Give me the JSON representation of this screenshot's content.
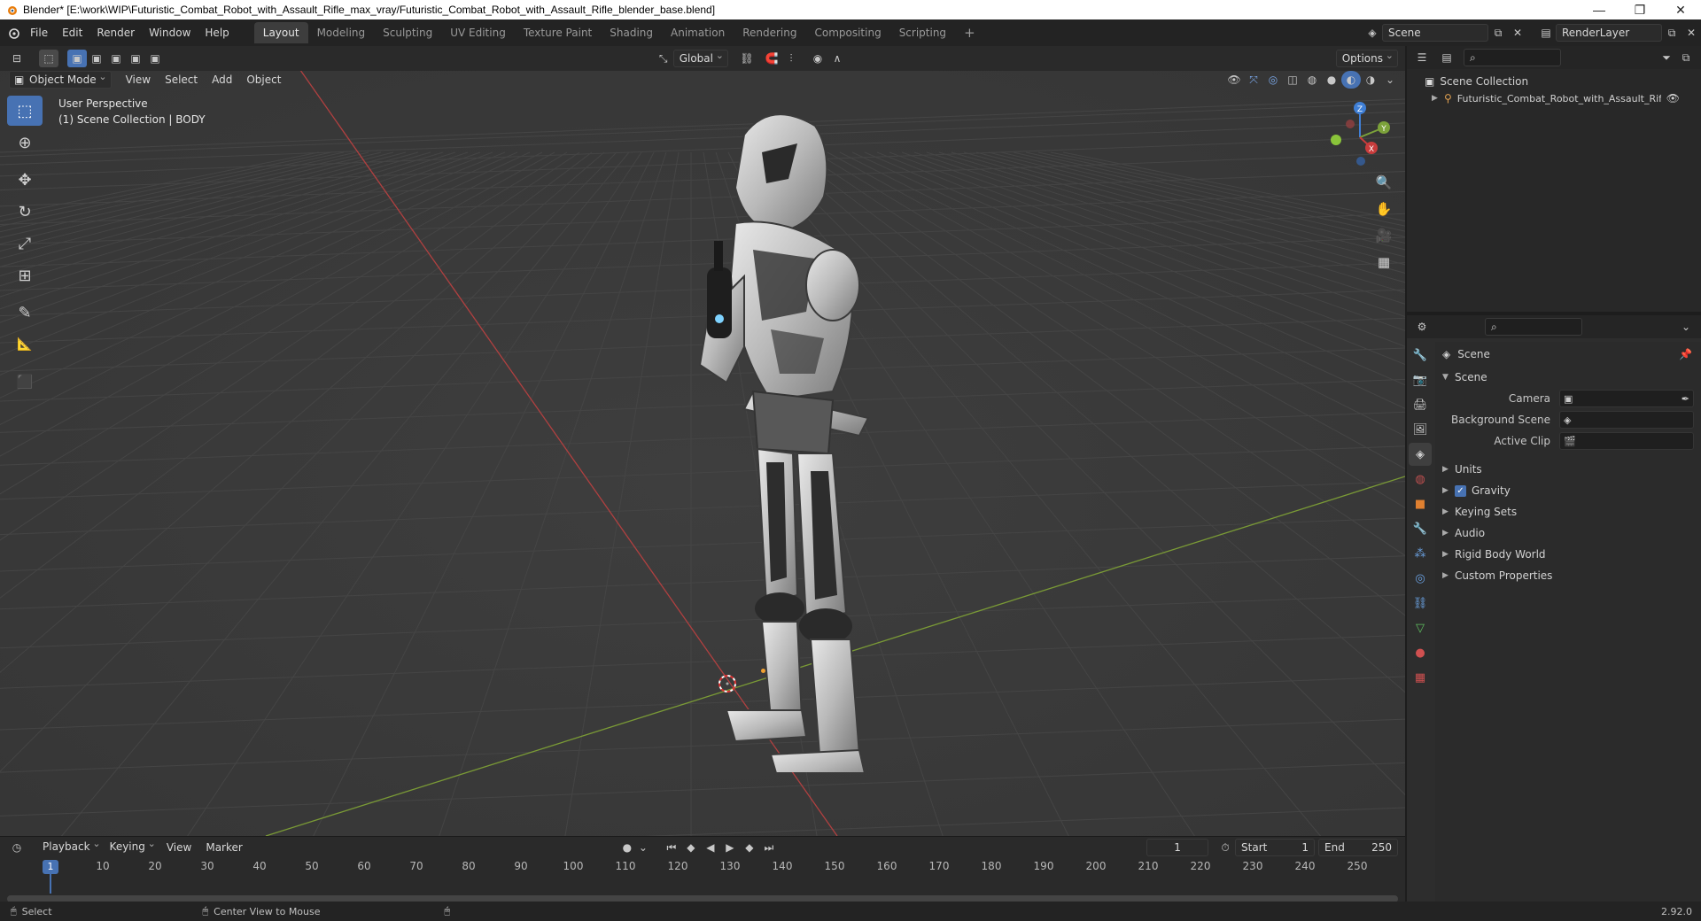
{
  "window": {
    "title": "Blender* [E:\\work\\WIP\\Futuristic_Combat_Robot_with_Assault_Rifle_max_vray/Futuristic_Combat_Robot_with_Assault_Rifle_blender_base.blend]",
    "minimize": "—",
    "maximize": "❐",
    "close": "✕"
  },
  "menubar": {
    "items": [
      "File",
      "Edit",
      "Render",
      "Window",
      "Help"
    ],
    "workspaces": [
      "Layout",
      "Modeling",
      "Sculpting",
      "UV Editing",
      "Texture Paint",
      "Shading",
      "Animation",
      "Rendering",
      "Compositing",
      "Scripting"
    ],
    "active_workspace": "Layout",
    "add_workspace": "+",
    "scene_name": "Scene",
    "render_layer": "RenderLayer"
  },
  "viewport_header": {
    "transform_orientation": "Global",
    "options_label": "Options",
    "mode": "Object Mode",
    "menus": [
      "View",
      "Select",
      "Add",
      "Object"
    ]
  },
  "viewport": {
    "perspective_label": "User Perspective",
    "collection_label": "(1) Scene Collection | BODY",
    "gizmo_axes": {
      "x": "X",
      "y": "Y",
      "z": "Z"
    },
    "tools": [
      {
        "name": "select-box-tool",
        "glyph": "⬚"
      },
      {
        "name": "cursor-tool",
        "glyph": "⊕"
      },
      {
        "name": "move-tool",
        "glyph": "✥"
      },
      {
        "name": "rotate-tool",
        "glyph": "↻"
      },
      {
        "name": "scale-tool",
        "glyph": "⤢"
      },
      {
        "name": "transform-tool",
        "glyph": "⊞"
      },
      {
        "name": "annotate-tool",
        "glyph": "✎"
      },
      {
        "name": "measure-tool",
        "glyph": "📐"
      },
      {
        "name": "add-cube-tool",
        "glyph": "⬛"
      }
    ]
  },
  "outliner": {
    "root": "Scene Collection",
    "items": [
      {
        "label": "Futuristic_Combat_Robot_with_Assault_Rifle"
      }
    ]
  },
  "properties": {
    "context_title": "Scene",
    "section_title": "Scene",
    "fields": [
      {
        "label": "Camera",
        "value": ""
      },
      {
        "label": "Background Scene",
        "value": ""
      },
      {
        "label": "Active Clip",
        "value": ""
      }
    ],
    "subpanels": [
      "Units",
      "Gravity",
      "Keying Sets",
      "Audio",
      "Rigid Body World",
      "Custom Properties"
    ],
    "gravity_checked": true
  },
  "timeline": {
    "menus": [
      "Playback",
      "Keying",
      "View",
      "Marker"
    ],
    "current_frame": "1",
    "start_label": "Start",
    "start_value": "1",
    "end_label": "End",
    "end_value": "250",
    "ticks": [
      "1",
      "10",
      "20",
      "30",
      "40",
      "50",
      "60",
      "70",
      "80",
      "90",
      "100",
      "110",
      "120",
      "130",
      "140",
      "150",
      "160",
      "170",
      "180",
      "190",
      "200",
      "210",
      "220",
      "230",
      "240",
      "250"
    ]
  },
  "statusbar": {
    "left": "Select",
    "middle": "Center View to Mouse",
    "version": "2.92.0"
  },
  "colors": {
    "accent": "#4772b3",
    "x_axis": "#c83c3c",
    "y_axis": "#7ca23a",
    "z_axis": "#3f7fd6"
  }
}
